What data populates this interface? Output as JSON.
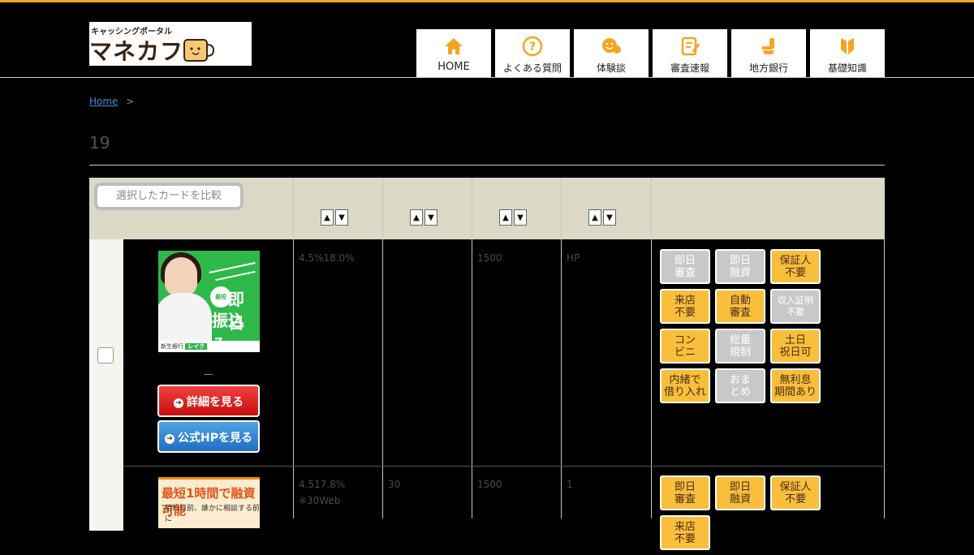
{
  "header": {
    "logo_small": "キャッシングポータル",
    "logo_big": "マネカフェ",
    "nav": [
      {
        "label": "HOME",
        "icon": "home-icon"
      },
      {
        "label": "よくある質問",
        "icon": "question-icon"
      },
      {
        "label": "体験談",
        "icon": "chat-face-icon"
      },
      {
        "label": "審査速報",
        "icon": "report-icon"
      },
      {
        "label": "地方銀行",
        "icon": "chair-icon"
      },
      {
        "label": "基礎知識",
        "icon": "beginner-icon"
      }
    ]
  },
  "breadcrumb": {
    "home": "Home",
    "sep": ">"
  },
  "page": {
    "title": "19"
  },
  "table": {
    "compare_label": "選択したカードを比較",
    "sort_up": "▲",
    "sort_down": "▼"
  },
  "rows": [
    {
      "banner_badge": "最短",
      "banner_line1": "即日",
      "banner_line2": "振込み",
      "banner_footer": "新生銀行",
      "banner_brand": "レイク",
      "link_text": "　",
      "detail_label": "詳細を見る",
      "official_label": "公式HPを見る",
      "rate": "4.5%18.0%",
      "col2": "",
      "limit": "1500",
      "col4": "HP",
      "tags": [
        {
          "text": "即日\n審査",
          "on": false
        },
        {
          "text": "即日\n融資",
          "on": false
        },
        {
          "text": "保証人\n不要",
          "on": true
        },
        {
          "text": "来店\n不要",
          "on": true
        },
        {
          "text": "自動\n審査",
          "on": true
        },
        {
          "text": "収入証明\n不要",
          "on": false,
          "small": true
        },
        {
          "text": "コン\nビニ",
          "on": true
        },
        {
          "text": "総量\n規制",
          "on": false
        },
        {
          "text": "土日\n祝日可",
          "on": true
        },
        {
          "text": "内緒で\n借り入れ",
          "on": true
        },
        {
          "text": "おま\nとめ",
          "on": false
        },
        {
          "text": "無利息\n期間あり",
          "on": true
        }
      ]
    },
    {
      "banner_line1": "最短1時間で融資可能",
      "banner_line2": "給料日前、誰かに相談する前に",
      "rate": "4.517.8%",
      "rate_note": "※30Web",
      "col2": "30",
      "limit": "1500",
      "col4": "1",
      "tags": [
        {
          "text": "即日\n審査",
          "on": true
        },
        {
          "text": "即日\n融資",
          "on": true
        },
        {
          "text": "保証人\n不要",
          "on": true
        },
        {
          "text": "来店\n不要",
          "on": true
        }
      ]
    }
  ],
  "colors": {
    "accent": "#f4a623",
    "tag_on": "#f8be3c",
    "tag_off": "#c8c8c8",
    "link": "#3b8fd6"
  }
}
